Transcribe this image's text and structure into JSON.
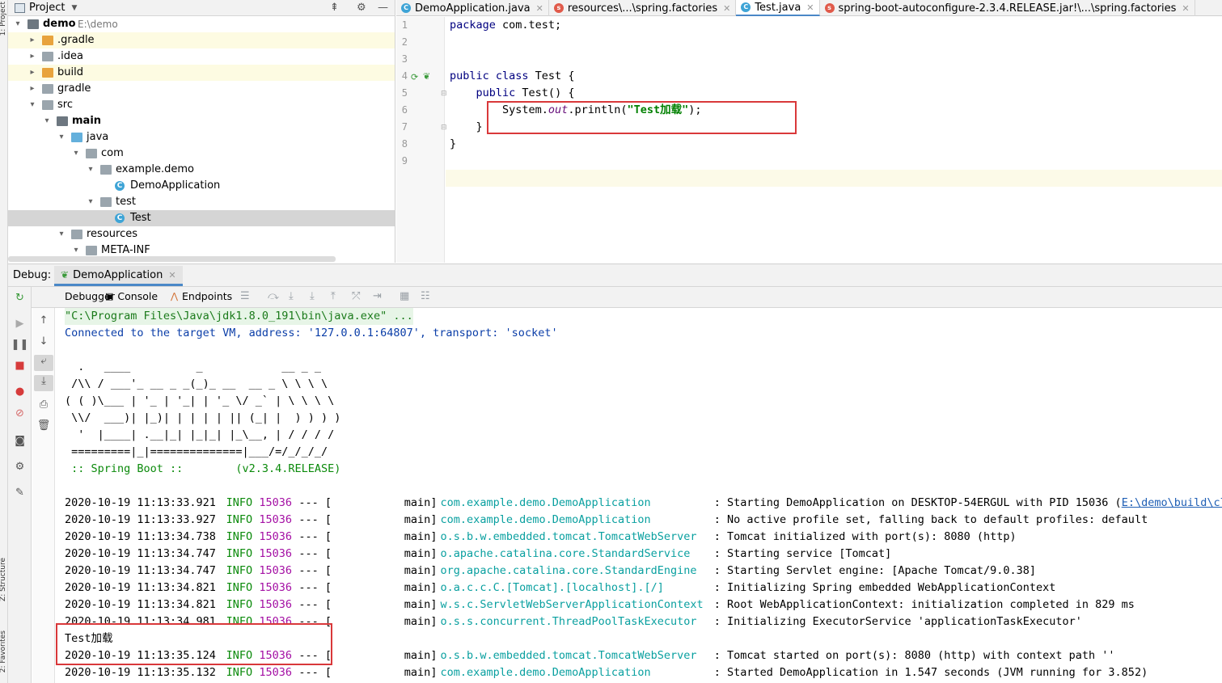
{
  "left_strip": {
    "top_label": "1: Project",
    "structure_label": "Z: Structure",
    "favorites_label": "2: Favorites"
  },
  "project": {
    "title": "Project",
    "tree": [
      {
        "label": "demo",
        "path": "E:\\demo",
        "bold": true,
        "arrow": "▾",
        "icon": "folder-dark",
        "depth": 0
      },
      {
        "label": ".gradle",
        "arrow": "▸",
        "icon": "folder-orange",
        "depth": 1,
        "hl": true
      },
      {
        "label": ".idea",
        "arrow": "▸",
        "icon": "folder-gray",
        "depth": 1
      },
      {
        "label": "build",
        "arrow": "▸",
        "icon": "folder-orange",
        "depth": 1,
        "hl": true
      },
      {
        "label": "gradle",
        "arrow": "▸",
        "icon": "folder-gray",
        "depth": 1
      },
      {
        "label": "src",
        "arrow": "▾",
        "icon": "folder-gray",
        "depth": 1
      },
      {
        "label": "main",
        "arrow": "▾",
        "icon": "folder-dark",
        "depth": 2,
        "bold": true
      },
      {
        "label": "java",
        "arrow": "▾",
        "icon": "folder-blue",
        "depth": 3
      },
      {
        "label": "com",
        "arrow": "▾",
        "icon": "folder-gray",
        "depth": 4
      },
      {
        "label": "example.demo",
        "arrow": "▾",
        "icon": "folder-gray",
        "depth": 5
      },
      {
        "label": "DemoApplication",
        "arrow": "",
        "icon": "class",
        "depth": 6
      },
      {
        "label": "test",
        "arrow": "▾",
        "icon": "folder-gray",
        "depth": 5
      },
      {
        "label": "Test",
        "arrow": "",
        "icon": "class",
        "depth": 6,
        "sel": true
      },
      {
        "label": "resources",
        "arrow": "▾",
        "icon": "folder-gray",
        "depth": 3
      },
      {
        "label": "META-INF",
        "arrow": "▾",
        "icon": "folder-gray",
        "depth": 4
      }
    ]
  },
  "editor": {
    "tabs": [
      {
        "label": "DemoApplication.java",
        "icon": "C",
        "color": "#3ea4d6",
        "active": false
      },
      {
        "label": "resources\\...\\spring.factories",
        "icon": "s",
        "color": "#e05a4a",
        "active": false
      },
      {
        "label": "Test.java",
        "icon": "C",
        "color": "#3ea4d6",
        "active": true
      },
      {
        "label": "spring-boot-autoconfigure-2.3.4.RELEASE.jar!\\...\\spring.factories",
        "icon": "s",
        "color": "#e05a4a",
        "active": false
      }
    ],
    "line_numbers": [
      "1",
      "2",
      "3",
      "4",
      "5",
      "6",
      "7",
      "8",
      "9"
    ],
    "code": {
      "l1_kw": "package",
      "l1_rest": " com.test;",
      "l4_kw": "public class",
      "l4_rest": " Test {",
      "l5_indent": "    ",
      "l5_kw": "public",
      "l5_rest": " Test() {",
      "l6_pre": "        System.",
      "l6_it": "out",
      "l6_mid": ".println(",
      "l6_str": "\"Test加载\"",
      "l6_end": ");",
      "l7": "    }",
      "l8": "}"
    }
  },
  "debug": {
    "label": "Debug:",
    "tab": "DemoApplication",
    "tools": {
      "debugger": "Debugger",
      "console": "Console",
      "endpoints": "Endpoints"
    }
  },
  "console": {
    "cmd": "\"C:\\Program Files\\Java\\jdk1.8.0_191\\bin\\java.exe\" ...",
    "connected": "Connected to the target VM, address: '127.0.0.1:64807', transport: 'socket'",
    "banner": [
      "  .   ____          _            __ _ _",
      " /\\\\ / ___'_ __ _ _(_)_ __  __ _ \\ \\ \\ \\",
      "( ( )\\___ | '_ | '_| | '_ \\/ _` | \\ \\ \\ \\",
      " \\\\/  ___)| |_)| | | | | || (_| |  ) ) ) )",
      "  '  |____| .__|_| |_|_| |_\\__, | / / / /",
      " =========|_|==============|___/=/_/_/_/"
    ],
    "spring_boot": " :: Spring Boot ::        (v2.3.4.RELEASE)",
    "logs": [
      {
        "ts": "2020-10-19 11:13:33.921",
        "level": "INFO",
        "pid": "15036",
        "thread": "main",
        "logger": "com.example.demo.DemoApplication",
        "msg": ": Starting DemoApplication on DESKTOP-54ERGUL with PID 15036 (",
        "link": "E:\\demo\\build\\clas"
      },
      {
        "ts": "2020-10-19 11:13:33.927",
        "level": "INFO",
        "pid": "15036",
        "thread": "main",
        "logger": "com.example.demo.DemoApplication",
        "msg": ": No active profile set, falling back to default profiles: default"
      },
      {
        "ts": "2020-10-19 11:13:34.738",
        "level": "INFO",
        "pid": "15036",
        "thread": "main",
        "logger": "o.s.b.w.embedded.tomcat.TomcatWebServer",
        "msg": ": Tomcat initialized with port(s): 8080 (http)"
      },
      {
        "ts": "2020-10-19 11:13:34.747",
        "level": "INFO",
        "pid": "15036",
        "thread": "main",
        "logger": "o.apache.catalina.core.StandardService",
        "msg": ": Starting service [Tomcat]"
      },
      {
        "ts": "2020-10-19 11:13:34.747",
        "level": "INFO",
        "pid": "15036",
        "thread": "main",
        "logger": "org.apache.catalina.core.StandardEngine",
        "msg": ": Starting Servlet engine: [Apache Tomcat/9.0.38]"
      },
      {
        "ts": "2020-10-19 11:13:34.821",
        "level": "INFO",
        "pid": "15036",
        "thread": "main",
        "logger": "o.a.c.c.C.[Tomcat].[localhost].[/]",
        "msg": ": Initializing Spring embedded WebApplicationContext"
      },
      {
        "ts": "2020-10-19 11:13:34.821",
        "level": "INFO",
        "pid": "15036",
        "thread": "main",
        "logger": "w.s.c.ServletWebServerApplicationContext",
        "msg": ": Root WebApplicationContext: initialization completed in 829 ms"
      },
      {
        "ts": "2020-10-19 11:13:34.981",
        "level": "INFO",
        "pid": "15036",
        "thread": "main",
        "logger": "o.s.s.concurrent.ThreadPoolTaskExecutor",
        "msg": ": Initializing ExecutorService 'applicationTaskExecutor'"
      },
      {
        "plain": "Test加载"
      },
      {
        "ts": "2020-10-19 11:13:35.124",
        "level": "INFO",
        "pid": "15036",
        "thread": "main",
        "logger": "o.s.b.w.embedded.tomcat.TomcatWebServer",
        "msg": ": Tomcat started on port(s): 8080 (http) with context path ''"
      },
      {
        "ts": "2020-10-19 11:13:35.132",
        "level": "INFO",
        "pid": "15036",
        "thread": "main",
        "logger": "com.example.demo.DemoApplication",
        "msg": ": Started DemoApplication in 1.547 seconds (JVM running for 3.852)"
      }
    ]
  }
}
